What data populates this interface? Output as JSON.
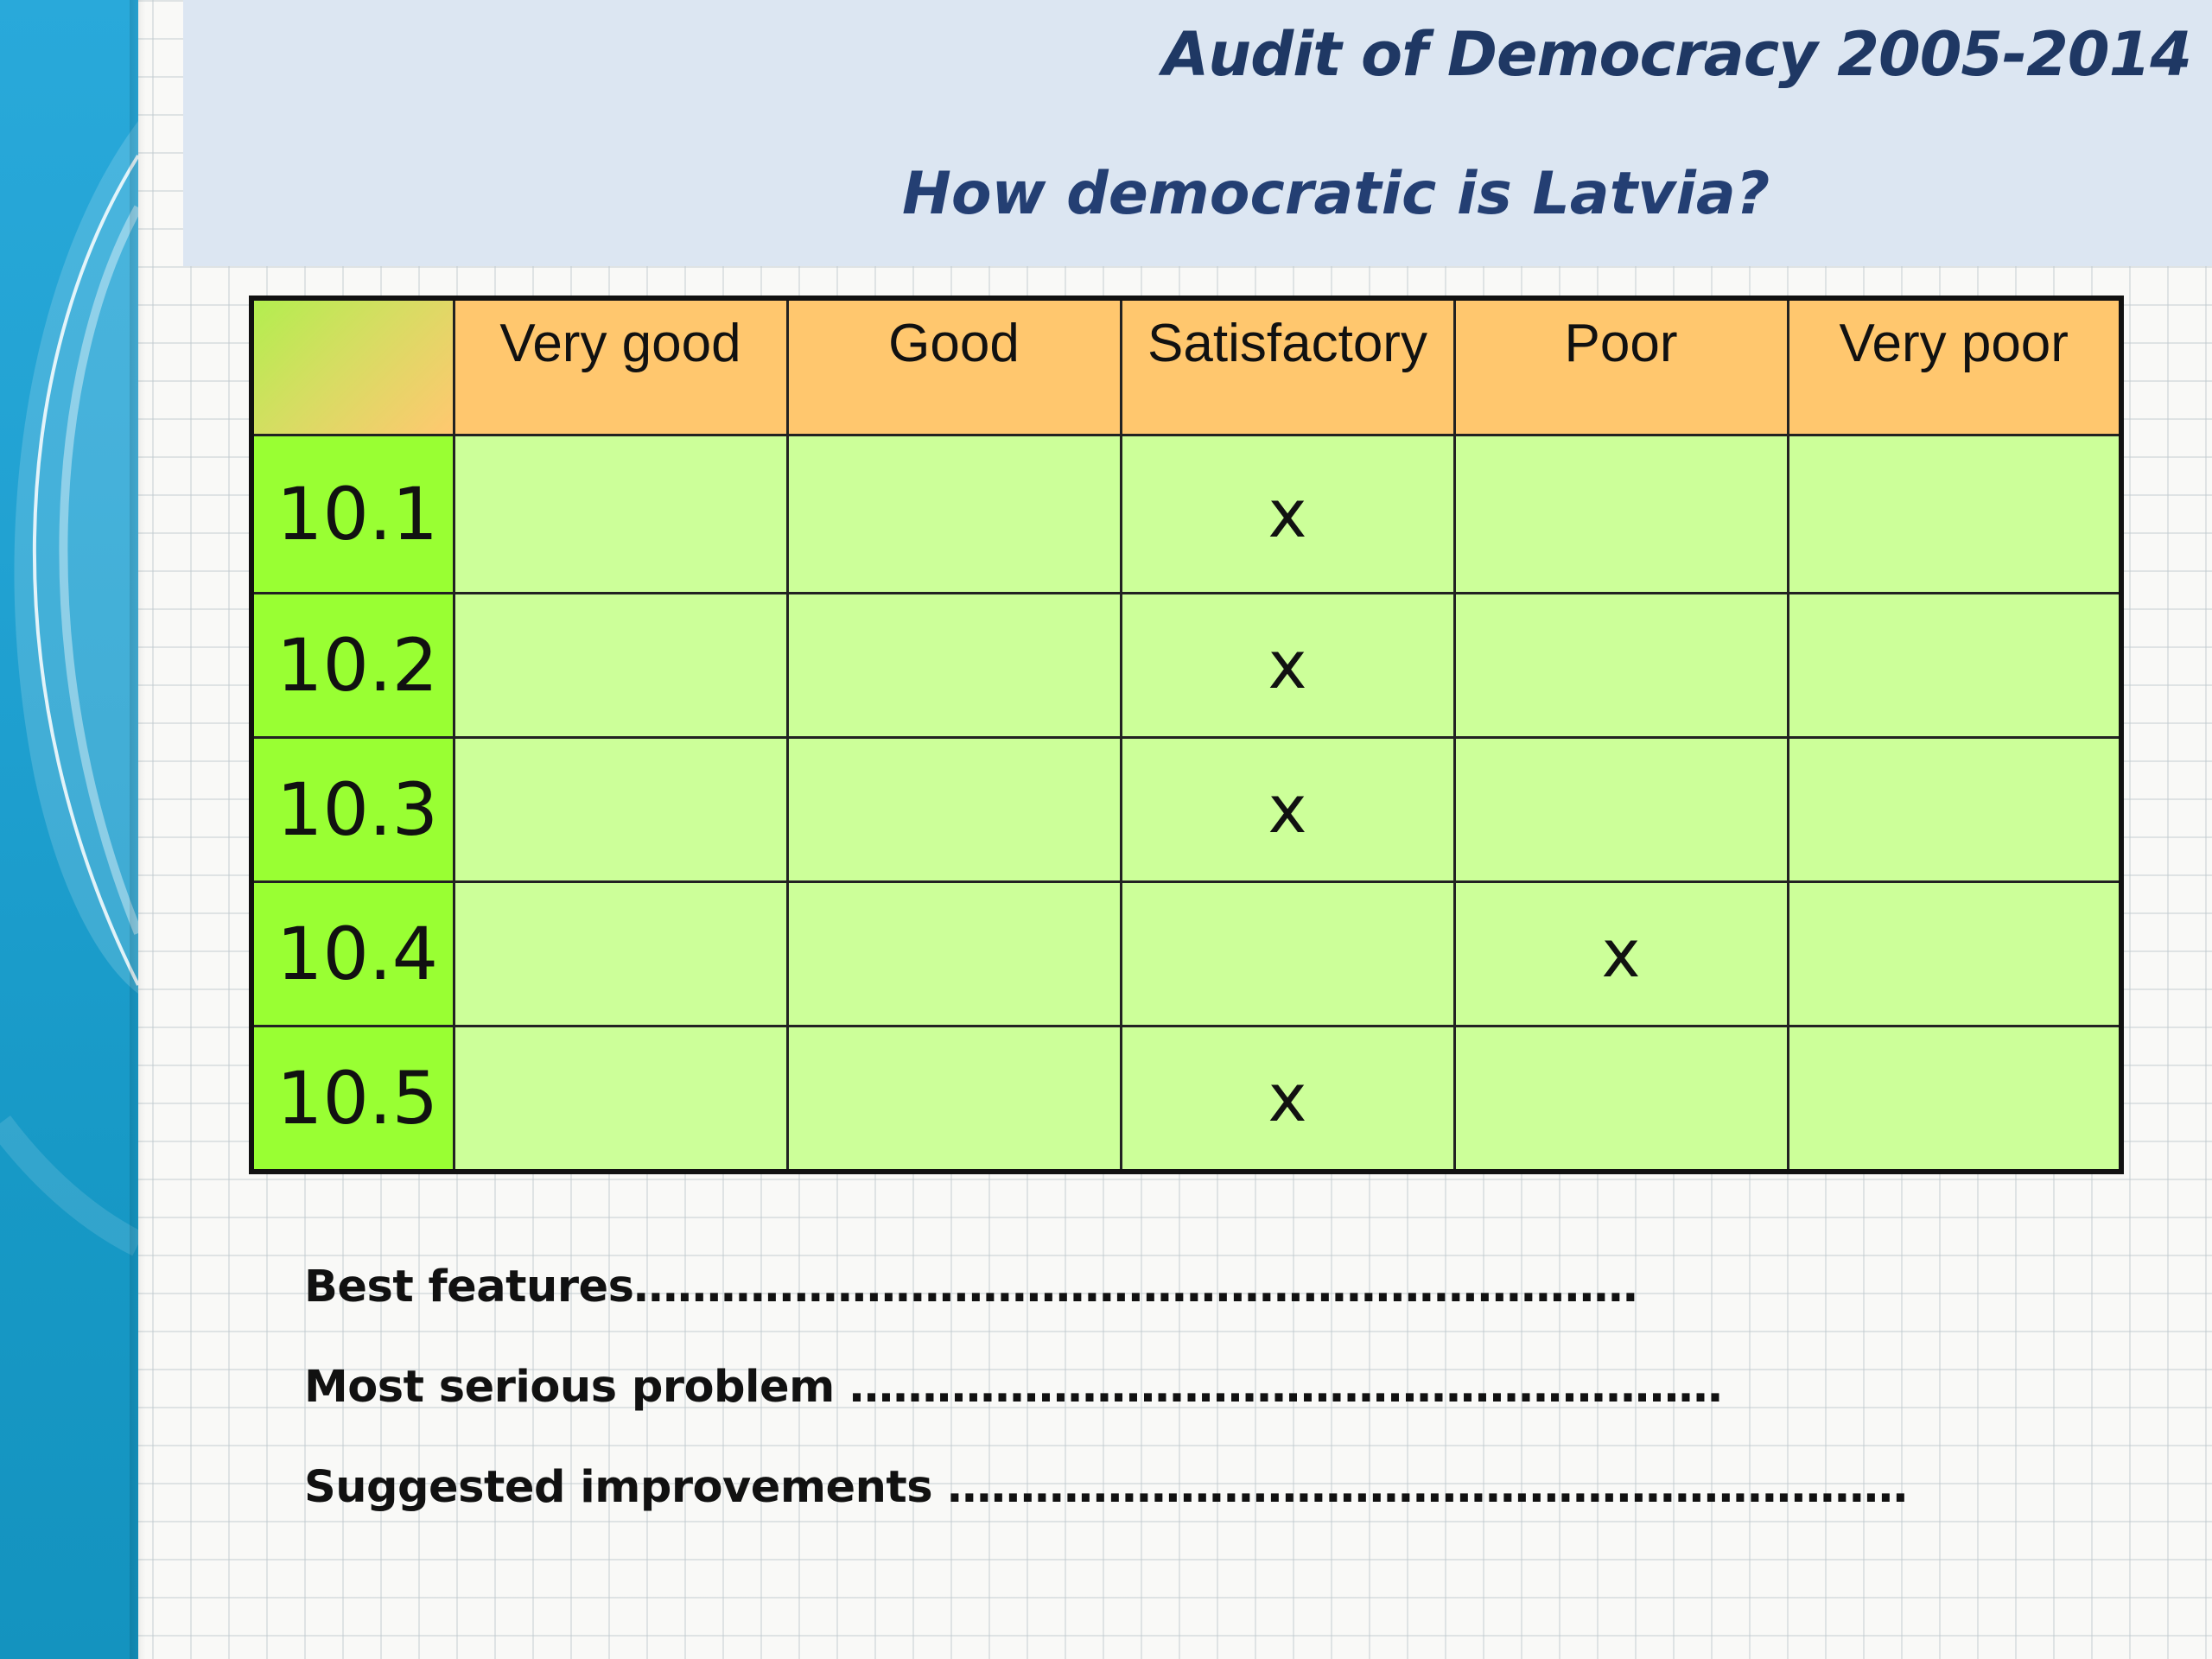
{
  "slide": {
    "title": "Audit of Democracy 2005-2014",
    "subtitle": "How democratic is Latvia?"
  },
  "table": {
    "columns": [
      "Very good",
      "Good",
      "Satisfactory",
      "Poor",
      "Very poor"
    ],
    "rows": [
      {
        "label": "10.1",
        "cells": [
          "",
          "",
          "x",
          "",
          ""
        ]
      },
      {
        "label": "10.2",
        "cells": [
          "",
          "",
          "x",
          "",
          ""
        ]
      },
      {
        "label": "10.3",
        "cells": [
          "",
          "",
          "x",
          "",
          ""
        ]
      },
      {
        "label": "10.4",
        "cells": [
          "",
          "",
          "",
          "x",
          ""
        ]
      },
      {
        "label": "10.5",
        "cells": [
          "",
          "",
          "x",
          "",
          ""
        ]
      }
    ]
  },
  "notes": [
    "Best features……………………………………………………………",
    "Most serious problem ……………………………………………………",
    "Suggested improvements …………………………………………………………"
  ],
  "colors": {
    "side_band": "#1e9fcf",
    "header_band": "#dce6f2",
    "title_text": "#1f3864",
    "table_header": "#ffc76e",
    "row_label_cell": "#99ff33",
    "data_cell": "#ccff99"
  }
}
